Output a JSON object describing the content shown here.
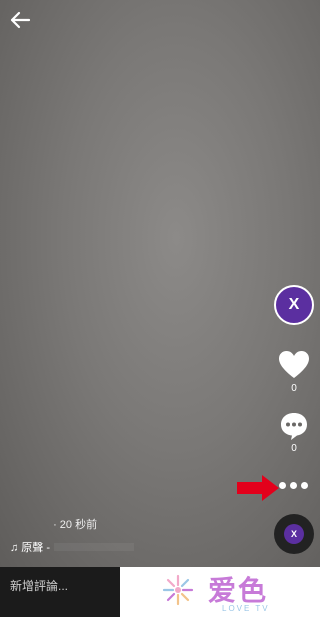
{
  "header": {
    "back_icon": "arrow-left-icon"
  },
  "sidebar": {
    "avatar_text": "X",
    "like_count": "0",
    "comment_count": "0",
    "more_icon": "more-dots-icon",
    "disc_text": "X"
  },
  "caption": {
    "time": "· 20 秒前",
    "sound_prefix": "♫ 原聲 -"
  },
  "comment": {
    "placeholder": "新增評論..."
  },
  "watermark": {
    "title": "爱色",
    "subtitle": "LOVE TV"
  },
  "colors": {
    "accent": "#5b2fa0",
    "arrow": "#e3001b",
    "brand_pink": "#c77ad8",
    "brand_blue": "#9bc6e6"
  }
}
